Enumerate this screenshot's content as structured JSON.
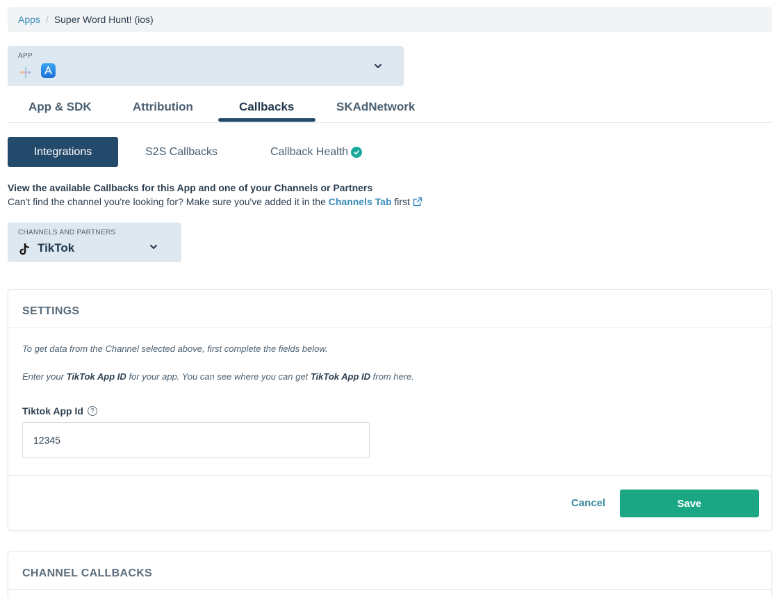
{
  "breadcrumb": {
    "root": "Apps",
    "separator": "/",
    "current": "Super Word Hunt! (ios)"
  },
  "app_select": {
    "label": "APP"
  },
  "main_tabs": [
    {
      "label": "App & SDK"
    },
    {
      "label": "Attribution"
    },
    {
      "label": "Callbacks"
    },
    {
      "label": "SKAdNetwork"
    }
  ],
  "sub_tabs": {
    "integrations": "Integrations",
    "s2s": "S2S Callbacks",
    "health": "Callback Health"
  },
  "info": {
    "line1": "View the available Callbacks for this App and one of your Channels or Partners",
    "line2_prefix": "Can't find the channel you're looking for? Make sure you've added it in the",
    "line2_link": "Channels Tab",
    "line2_suffix": "first"
  },
  "channel_select": {
    "label": "CHANNELS AND PARTNERS",
    "value": "TikTok"
  },
  "settings": {
    "title": "SETTINGS",
    "note1": "To get data from the Channel selected above, first complete the fields below.",
    "note2_a": "Enter your",
    "note2_b": "TikTok App ID",
    "note2_c": "for your app. You can see where you can get",
    "note2_d": "TikTok App ID",
    "note2_e": "from here.",
    "field_label": "Tiktok App Id",
    "field_value": "12345",
    "cancel": "Cancel",
    "save": "Save"
  },
  "channel_callbacks": {
    "title": "CHANNEL CALLBACKS"
  },
  "colors": {
    "primary": "#244a6b",
    "save": "#1ba684",
    "link": "#3a8dbb",
    "health_ok": "#19a99a"
  }
}
